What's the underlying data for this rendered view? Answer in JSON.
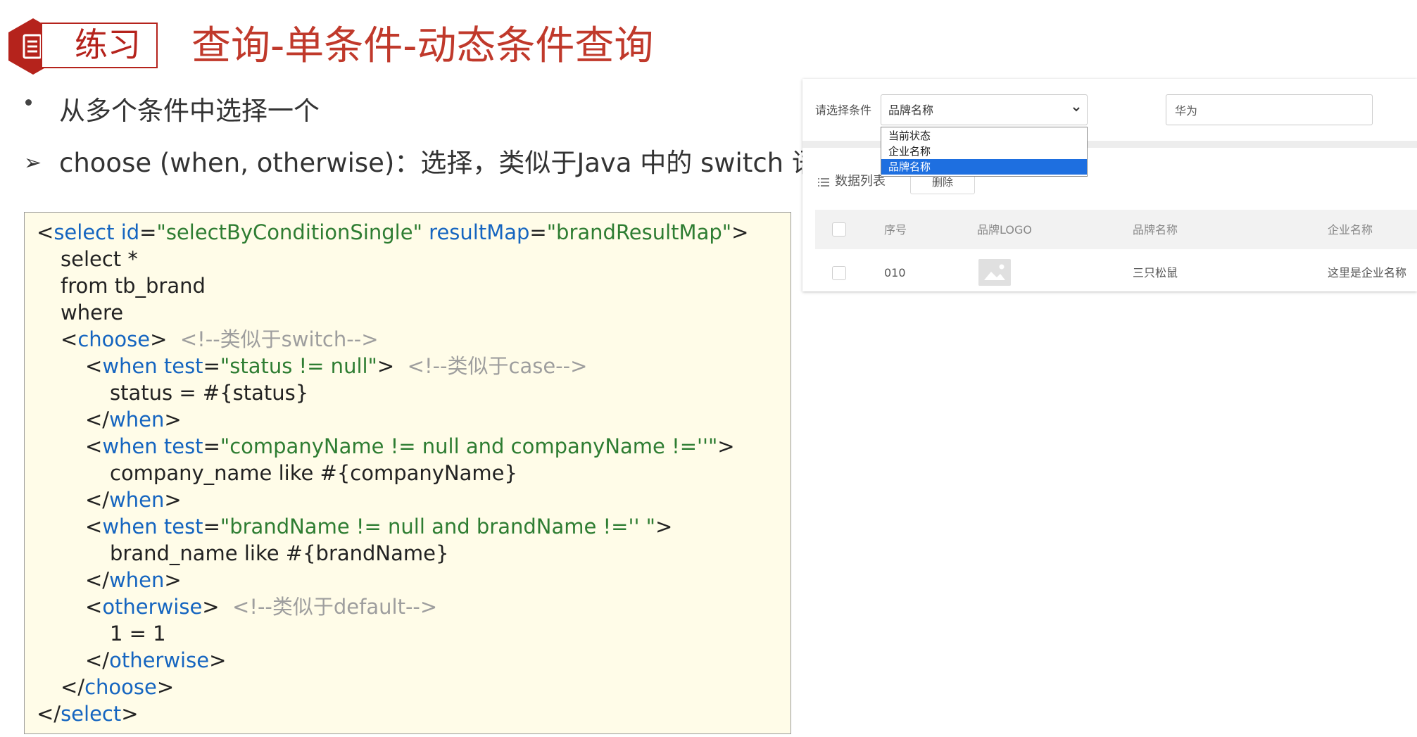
{
  "header": {
    "tag": "练习",
    "title": "查询-单条件-动态条件查询",
    "icon": "document-icon",
    "accent": "#b5231c"
  },
  "bullets": [
    "从多个条件中选择一个",
    "choose (when, otherwise)：选择，类似于Java 中的 switch 语句"
  ],
  "code": {
    "l1": {
      "a": "<",
      "b": "select",
      "c": " ",
      "d": "id",
      "e": "=",
      "f": "\"selectByConditionSingle\"",
      "g": " ",
      "h": "resultMap",
      "i": "=",
      "j": "\"brandResultMap\"",
      "k": ">"
    },
    "l2": "select *",
    "l3": "from tb_brand",
    "l4": "where",
    "l5": {
      "a": "<",
      "b": "choose",
      "c": ">",
      "d": "<!--类似于switch-->"
    },
    "l6": {
      "a": "<",
      "b": "when",
      "c": " ",
      "d": "test",
      "e": "=",
      "f": "\"status != null\"",
      "g": ">",
      "h": "<!--类似于case-->"
    },
    "l7": "status = #{status}",
    "l8": {
      "a": "</",
      "b": "when",
      "c": ">"
    },
    "l9": {
      "a": "<",
      "b": "when",
      "c": " ",
      "d": "test",
      "e": "=",
      "f": "\"companyName != null and companyName !=''\"",
      "g": ">"
    },
    "l10": "company_name like #{companyName}",
    "l11": {
      "a": "</",
      "b": "when",
      "c": ">"
    },
    "l12": {
      "a": "<",
      "b": "when",
      "c": " ",
      "d": "test",
      "e": "=",
      "f": "\"brandName != null and brandName !='' \"",
      "g": ">"
    },
    "l13": "brand_name like #{brandName}",
    "l14": {
      "a": "</",
      "b": "when",
      "c": ">"
    },
    "l15": {
      "a": "<",
      "b": "otherwise",
      "c": ">",
      "d": "<!--类似于default-->"
    },
    "l16": "1 = 1",
    "l17": {
      "a": "</",
      "b": "otherwise",
      "c": ">"
    },
    "l18": {
      "a": "</",
      "b": "choose",
      "c": ">"
    },
    "l19": {
      "a": "</",
      "b": "select",
      "c": ">"
    }
  },
  "form": {
    "label": "请选择条件",
    "select_value": "品牌名称",
    "options": [
      "当前状态",
      "企业名称",
      "品牌名称"
    ],
    "input_value": "华为"
  },
  "list": {
    "label": "数据列表",
    "delete_label": "删除",
    "columns": [
      "序号",
      "品牌LOGO",
      "品牌名称",
      "企业名称"
    ],
    "rows": [
      {
        "id": "010",
        "brand": "三只松鼠",
        "company": "这里是企业名称"
      }
    ]
  },
  "colors": {
    "keyword": "#1565c0",
    "string": "#2e7d32",
    "comment": "#9e9e9e",
    "selected_option": "#1e6fe0"
  }
}
